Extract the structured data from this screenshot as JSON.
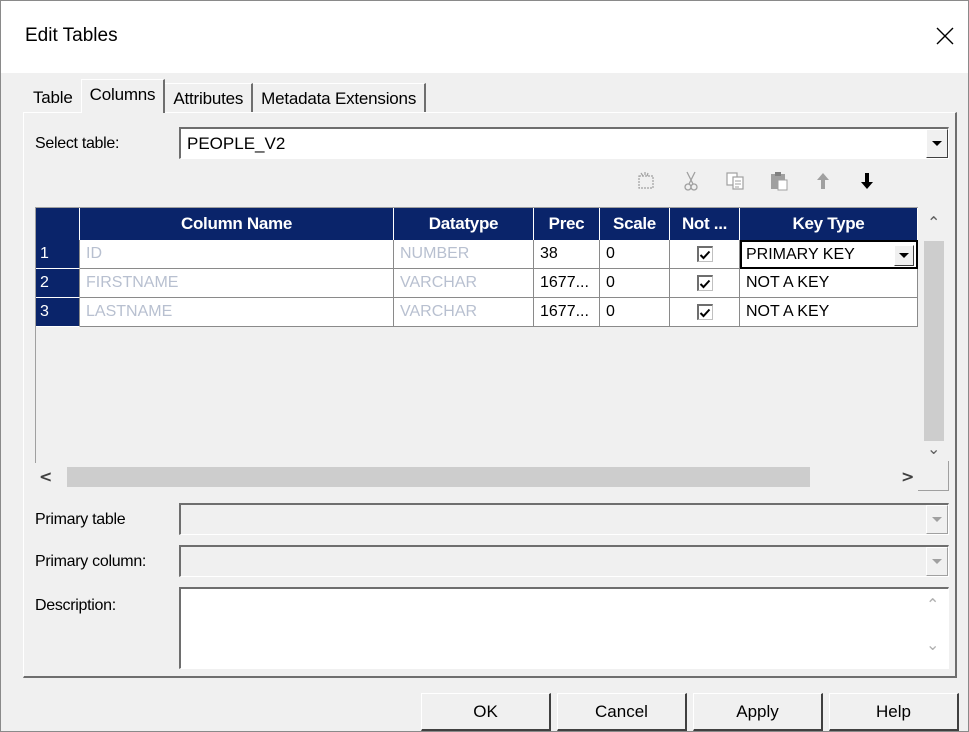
{
  "window": {
    "title": "Edit Tables"
  },
  "tabs": [
    {
      "label": "Table",
      "selected": false
    },
    {
      "label": "Columns",
      "selected": true
    },
    {
      "label": "Attributes",
      "selected": false
    },
    {
      "label": "Metadata Extensions",
      "selected": false
    }
  ],
  "select_table": {
    "label": "Select table:",
    "value": "PEOPLE_V2"
  },
  "toolbar": {
    "icons": [
      "new-column-icon",
      "cut-icon",
      "copy-icon",
      "paste-icon",
      "move-up-icon",
      "move-down-icon"
    ]
  },
  "grid": {
    "headers": {
      "column_name": "Column Name",
      "datatype": "Datatype",
      "prec": "Prec",
      "scale": "Scale",
      "not_null": "Not ...",
      "key_type": "Key Type"
    },
    "rows": [
      {
        "num": "1",
        "name": "ID",
        "datatype": "NUMBER",
        "prec": "38",
        "scale": "0",
        "not_null": true,
        "key_type": "PRIMARY KEY"
      },
      {
        "num": "2",
        "name": "FIRSTNAME",
        "datatype": "VARCHAR",
        "prec": "1677...",
        "scale": "0",
        "not_null": true,
        "key_type": "NOT A KEY"
      },
      {
        "num": "3",
        "name": "LASTNAME",
        "datatype": "VARCHAR",
        "prec": "1677...",
        "scale": "0",
        "not_null": true,
        "key_type": "NOT A KEY"
      }
    ]
  },
  "primary_table": {
    "label": "Primary table",
    "value": ""
  },
  "primary_column": {
    "label": "Primary column:",
    "value": ""
  },
  "description": {
    "label": "Description:",
    "value": ""
  },
  "buttons": {
    "ok": "OK",
    "cancel": "Cancel",
    "apply": "Apply",
    "help": "Help"
  },
  "colors": {
    "header_bg": "#0a246a",
    "disabled_text": "#b8c0d0",
    "dialog_bg": "#f0f0f0"
  }
}
